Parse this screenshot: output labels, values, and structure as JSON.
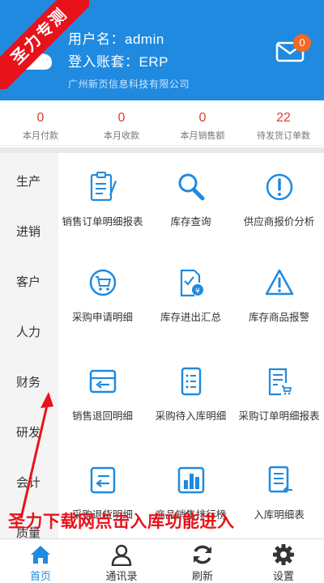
{
  "header": {
    "username_line": "用户名：admin",
    "account_line": "登入账套：ERP",
    "company": "广州新页信息科技有限公司",
    "mail_badge": "0",
    "ribbon": "圣力专测"
  },
  "stats": [
    {
      "value": "0",
      "label": "本月付款"
    },
    {
      "value": "0",
      "label": "本月收款"
    },
    {
      "value": "0",
      "label": "本月销售额"
    },
    {
      "value": "22",
      "label": "待发货订单数"
    }
  ],
  "sidebar": {
    "items": [
      {
        "label": "生产"
      },
      {
        "label": "进销"
      },
      {
        "label": "客户"
      },
      {
        "label": "人力"
      },
      {
        "label": "财务"
      },
      {
        "label": "研发"
      },
      {
        "label": "会计"
      },
      {
        "label": "质量"
      }
    ]
  },
  "grid": {
    "items": [
      {
        "label": "销售订单明细报表",
        "icon": "report-icon"
      },
      {
        "label": "库存查询",
        "icon": "search-icon"
      },
      {
        "label": "供应商报价分析",
        "icon": "alert-circle-icon"
      },
      {
        "label": "采购申请明细",
        "icon": "cart-icon"
      },
      {
        "label": "库存进出汇总",
        "icon": "stock-summary-icon"
      },
      {
        "label": "库存商品报警",
        "icon": "warning-icon"
      },
      {
        "label": "销售退回明细",
        "icon": "sales-return-icon"
      },
      {
        "label": "采购待入库明细",
        "icon": "list-icon"
      },
      {
        "label": "采购订单明细报表",
        "icon": "purchase-order-icon"
      },
      {
        "label": "采购退货明细",
        "icon": "purchase-return-icon"
      },
      {
        "label": "商品销售排行榜",
        "icon": "ranking-icon"
      },
      {
        "label": "入库明细表",
        "icon": "inbound-icon"
      }
    ]
  },
  "overlay_text": "圣力下载网点击入库功能进入",
  "tabbar": {
    "items": [
      {
        "label": "首页",
        "icon": "home-icon",
        "active": true
      },
      {
        "label": "通讯录",
        "icon": "contacts-icon"
      },
      {
        "label": "刷新",
        "icon": "refresh-icon"
      },
      {
        "label": "设置",
        "icon": "settings-icon"
      }
    ]
  },
  "colors": {
    "primary": "#1f8ae0",
    "accent_red": "#e2392f",
    "ribbon_red": "#e8121a",
    "badge_orange": "#f36a21"
  }
}
